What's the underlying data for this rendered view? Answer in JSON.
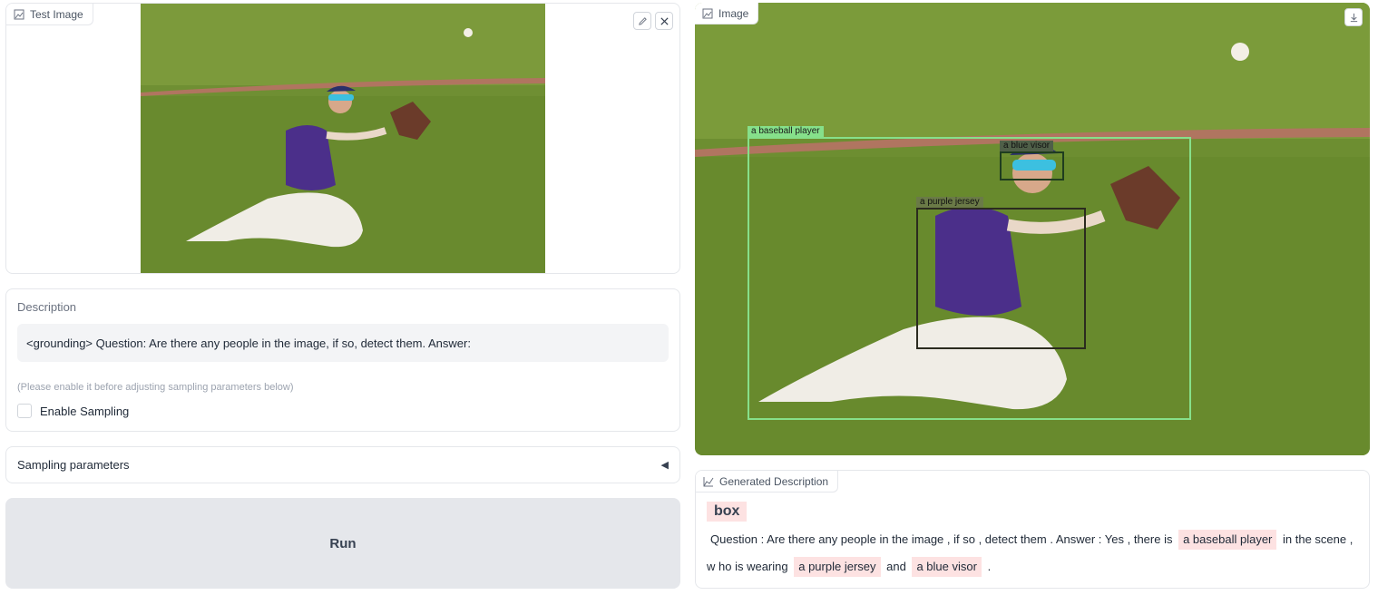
{
  "input_image": {
    "label": "Test Image",
    "edit_icon": "pencil-icon",
    "clear_icon": "close-icon"
  },
  "description": {
    "title": "Description",
    "prompt": "<grounding> Question: Are there any people in the image, if so, detect them.  Answer:",
    "hint": "(Please enable it before adjusting sampling parameters below)",
    "enable_sampling_label": "Enable Sampling",
    "enable_sampling_checked": false
  },
  "sampling": {
    "label": "Sampling parameters",
    "toggle_icon": "triangle-left-icon"
  },
  "run_button": {
    "label": "Run"
  },
  "output_image": {
    "label": "Image",
    "download_icon": "download-icon",
    "boxes": [
      {
        "label": "a baseball player",
        "color": "#86e08a"
      },
      {
        "label": "a blue visor",
        "color": "#1f3d1f"
      },
      {
        "label": "a purple jersey",
        "color": "#2b2b1f"
      }
    ]
  },
  "generated": {
    "label": "Generated Description",
    "tag": "box",
    "segments": [
      {
        "text": "Question : Are there any people in the image , if so , detect them . Answer : Yes , there is",
        "highlight": false
      },
      {
        "text": "a baseball player",
        "highlight": true
      },
      {
        "text": "in the scene , w ho is wearing",
        "highlight": false
      },
      {
        "text": "a purple jersey",
        "highlight": true
      },
      {
        "text": "and",
        "highlight": false
      },
      {
        "text": "a blue visor",
        "highlight": true
      },
      {
        "text": ".",
        "highlight": false
      }
    ]
  },
  "colors": {
    "grass": "#6f8f33",
    "jersey": "#4b2f8a",
    "chip": "#fde2e2"
  }
}
